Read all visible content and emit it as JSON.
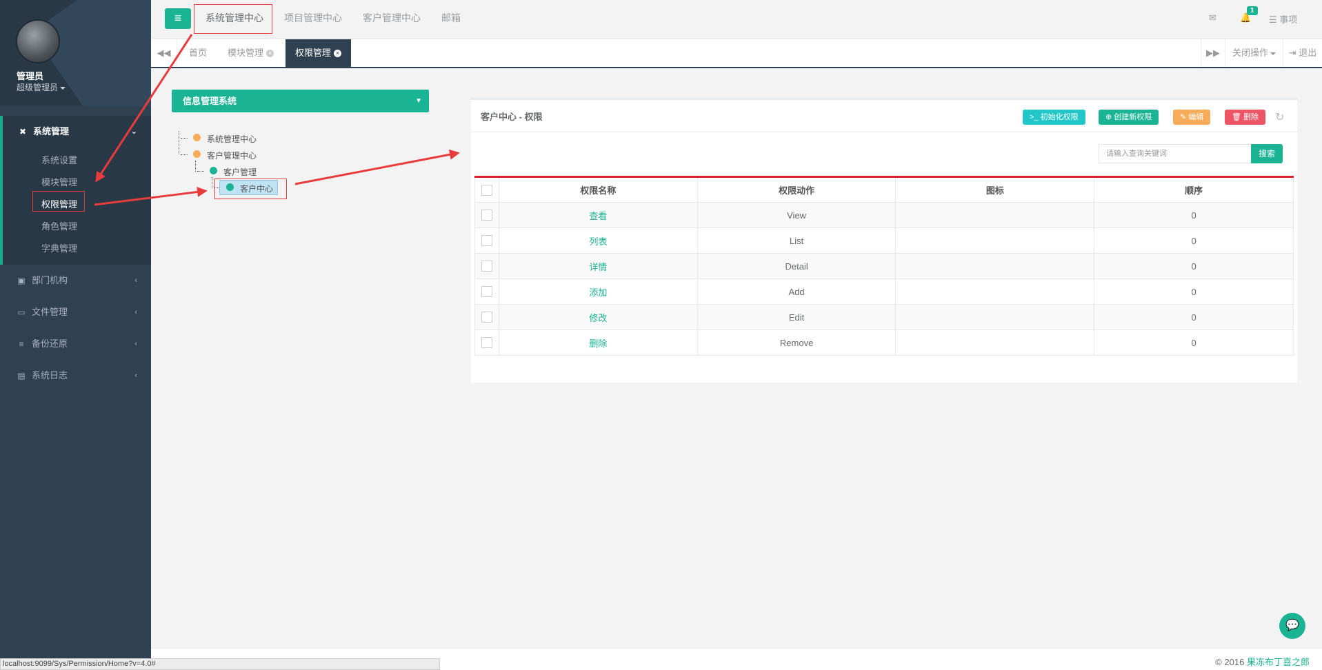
{
  "sidebar": {
    "user": {
      "name": "管理员",
      "role": "超级管理员"
    },
    "menu": [
      {
        "label": "系统管理",
        "icon": "wrench-icon"
      },
      {
        "label": "部门机构",
        "icon": "building-icon"
      },
      {
        "label": "文件管理",
        "icon": "folder-open-icon"
      },
      {
        "label": "备份还原",
        "icon": "database-icon"
      },
      {
        "label": "系统日志",
        "icon": "file-icon"
      }
    ],
    "submenu": [
      "系统设置",
      "模块管理",
      "权限管理",
      "角色管理",
      "字典管理"
    ]
  },
  "topnav": {
    "items": [
      "系统管理中心",
      "项目管理中心",
      "客户管理中心",
      "邮箱"
    ],
    "notification_count": "1",
    "tasks_label": "事项"
  },
  "tabs": {
    "items": [
      "首页",
      "模块管理",
      "权限管理"
    ],
    "close_ops": "关闭操作",
    "logout": "退出"
  },
  "tree": {
    "select_label": "信息管理系统",
    "nodes": [
      "系统管理中心",
      "客户管理中心",
      "客户管理",
      "客户中心"
    ]
  },
  "panel": {
    "title": "客户中心 - 权限",
    "buttons": {
      "init": "初始化权限",
      "create": "创建新权限",
      "edit": "编辑",
      "delete": "删除"
    },
    "search_placeholder": "请输入查询关键词",
    "search_button": "搜索",
    "columns": [
      "权限名称",
      "权限动作",
      "图标",
      "顺序"
    ],
    "rows": [
      {
        "name": "查看",
        "action": "View",
        "icon": "",
        "order": "0"
      },
      {
        "name": "列表",
        "action": "List",
        "icon": "",
        "order": "0"
      },
      {
        "name": "详情",
        "action": "Detail",
        "icon": "",
        "order": "0"
      },
      {
        "name": "添加",
        "action": "Add",
        "icon": "",
        "order": "0"
      },
      {
        "name": "修改",
        "action": "Edit",
        "icon": "",
        "order": "0"
      },
      {
        "name": "删除",
        "action": "Remove",
        "icon": "",
        "order": "0"
      }
    ]
  },
  "footer": {
    "copyright": "© 2016",
    "author": "果冻布丁喜之郎"
  },
  "status_url": "localhost:9099/Sys/Permission/Home?v=4.0#",
  "colors": {
    "accent": "#1ab394",
    "sidebar": "#2f4050",
    "annotation": "#e83c3c"
  }
}
